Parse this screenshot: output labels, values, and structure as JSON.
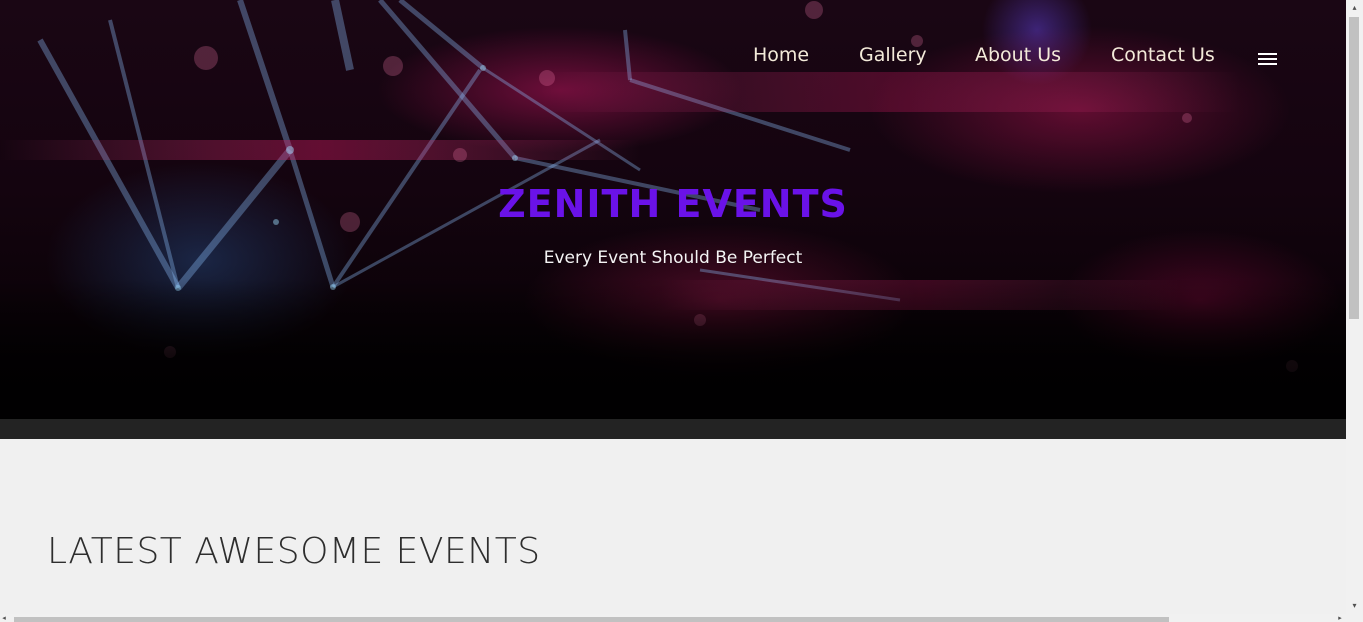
{
  "nav": {
    "items": [
      {
        "label": "Home"
      },
      {
        "label": "Gallery"
      },
      {
        "label": "About Us"
      },
      {
        "label": "Contact Us"
      }
    ],
    "menu_icon": "hamburger-menu-icon",
    "text_color": "#f3ead9"
  },
  "hero": {
    "title": "ZENITH EVENTS",
    "tagline": "Every Event Should Be Perfect",
    "title_color": "#6a12e8",
    "background": "concert crowd with stage lights"
  },
  "main": {
    "section_heading": "LATEST AWESOME EVENTS"
  },
  "scrollbars": {
    "vertical_icon_up": "triangle-up-icon",
    "vertical_icon_down": "triangle-down-icon",
    "horizontal_icon_left": "triangle-left-icon",
    "horizontal_icon_right": "triangle-right-icon"
  }
}
